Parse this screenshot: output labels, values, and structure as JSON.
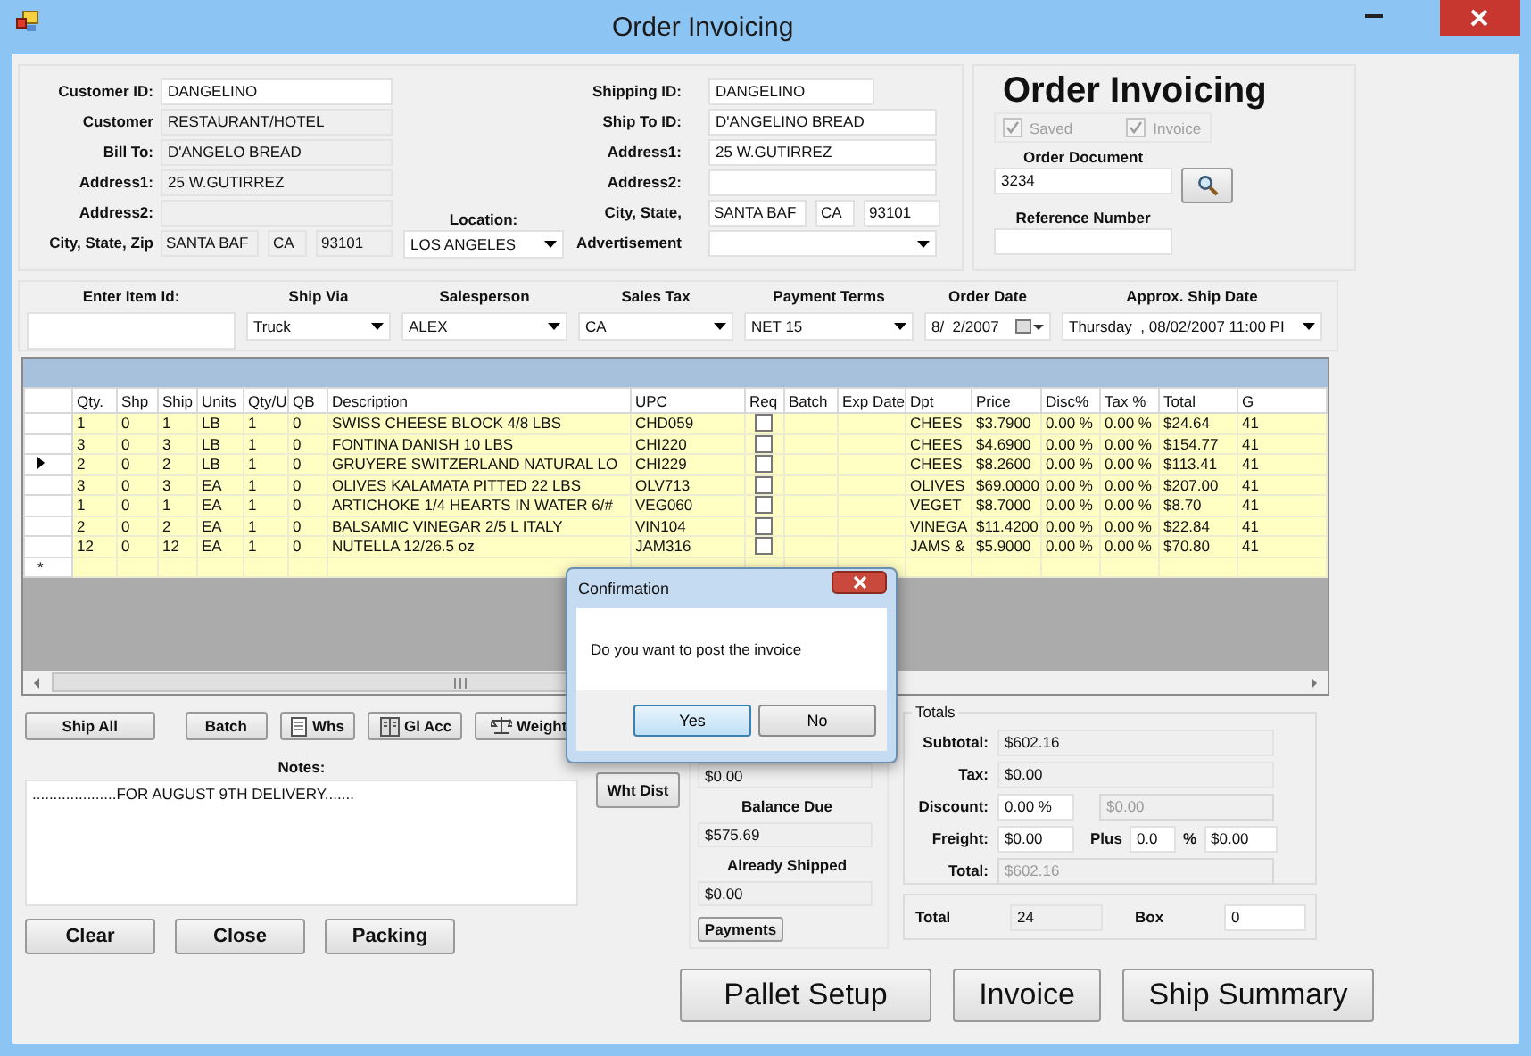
{
  "window": {
    "title": "Order Invoicing"
  },
  "customer": {
    "fields": [
      {
        "label": "Customer ID:",
        "kind": "single",
        "value": "DANGELINO",
        "readonly": false
      },
      {
        "label": "Customer",
        "kind": "single",
        "value": "RESTAURANT/HOTEL",
        "readonly": true
      },
      {
        "label": "Bill To:",
        "kind": "single",
        "value": "D'ANGELO BREAD",
        "readonly": true
      },
      {
        "label": "Address1:",
        "kind": "single",
        "value": "25 W.GUTIRREZ",
        "readonly": true
      },
      {
        "label": "Address2:",
        "kind": "single",
        "readonly": true
      },
      {
        "label": "City, State, Zip",
        "kind": "triple",
        "values": [
          "SANTA BAF",
          "CA",
          "93101"
        ],
        "readonly": true
      }
    ]
  },
  "location": {
    "label": "Location:",
    "value": "LOS ANGELES"
  },
  "shipping": {
    "fields": [
      {
        "label": "Shipping ID:",
        "kind": "short",
        "value": "DANGELINO",
        "readonly": false
      },
      {
        "label": "Ship To ID:",
        "kind": "single",
        "value": "D'ANGELINO BREAD",
        "readonly": false
      },
      {
        "label": "Address1:",
        "kind": "single",
        "value": "25 W.GUTIRREZ",
        "readonly": false
      },
      {
        "label": "Address2:",
        "kind": "single",
        "readonly": false
      },
      {
        "label": "City, State,",
        "kind": "triple",
        "values": [
          "SANTA BAF",
          "CA",
          "93101"
        ],
        "readonly": false
      },
      {
        "label": "Advertisement",
        "kind": "dropdown",
        "readonly": false
      }
    ]
  },
  "order_panel": {
    "heading": "Order Invoicing",
    "checks": [
      {
        "label": "Saved",
        "checked": true,
        "disabled": true
      },
      {
        "label": "Invoice",
        "checked": true,
        "disabled": true
      }
    ],
    "document_label": "Order Document",
    "document_value": "3234",
    "reference_label": "Reference Number"
  },
  "filters": [
    {
      "label": "Enter Item Id:",
      "kind": "text"
    },
    {
      "label": "Ship Via",
      "kind": "dropdown",
      "value": "Truck"
    },
    {
      "label": "Salesperson",
      "kind": "dropdown",
      "value": "ALEX"
    },
    {
      "label": "Sales Tax",
      "kind": "dropdown",
      "value": "CA"
    },
    {
      "label": "Payment Terms",
      "kind": "dropdown",
      "value": "NET 15"
    },
    {
      "label": "Order Date",
      "kind": "date",
      "value": "8/  2/2007"
    },
    {
      "label": "Approx. Ship  Date",
      "kind": "dropdown",
      "value": "Thursday  , 08/02/2007 11:00 PI"
    }
  ],
  "grid": {
    "columns": [
      {
        "label": "Qty.",
        "kind": "text"
      },
      {
        "label": "Shp",
        "kind": "text"
      },
      {
        "label": "Ship",
        "kind": "text"
      },
      {
        "label": "Units",
        "kind": "text"
      },
      {
        "label": "Qty/U",
        "kind": "text"
      },
      {
        "label": "QB",
        "kind": "text"
      },
      {
        "label": "Description",
        "kind": "text"
      },
      {
        "label": "UPC",
        "kind": "text"
      },
      {
        "label": "Req",
        "kind": "check"
      },
      {
        "label": "Batch",
        "kind": "empty"
      },
      {
        "label": "Exp Date",
        "kind": "empty"
      },
      {
        "label": "Dpt",
        "kind": "text"
      },
      {
        "label": "Price",
        "kind": "text"
      },
      {
        "label": "Disc%",
        "kind": "text"
      },
      {
        "label": "Tax %",
        "kind": "text"
      },
      {
        "label": "Total",
        "kind": "text"
      },
      {
        "label": "G",
        "kind": "text"
      }
    ],
    "rows": [
      {
        "selected": false,
        "req": false,
        "values": [
          "1",
          "0",
          "1",
          "LB",
          "1",
          "0",
          "SWISS CHEESE BLOCK 4/8 LBS",
          "CHD059",
          "CHEES",
          "$3.7900",
          "0.00 %",
          "0.00 %",
          "$24.64",
          "41"
        ]
      },
      {
        "selected": false,
        "req": false,
        "values": [
          "3",
          "0",
          "3",
          "LB",
          "1",
          "0",
          "FONTINA DANISH 10 LBS",
          "CHI220",
          "CHEES",
          "$4.6900",
          "0.00 %",
          "0.00 %",
          "$154.77",
          "41"
        ]
      },
      {
        "selected": true,
        "req": false,
        "values": [
          "2",
          "0",
          "2",
          "LB",
          "1",
          "0",
          "GRUYERE SWITZERLAND NATURAL LO",
          "CHI229",
          "CHEES",
          "$8.2600",
          "0.00 %",
          "0.00 %",
          "$113.41",
          "41"
        ]
      },
      {
        "selected": false,
        "req": false,
        "values": [
          "3",
          "0",
          "3",
          "EA",
          "1",
          "0",
          "OLIVES KALAMATA PITTED 22 LBS",
          "OLV713",
          "OLIVES",
          "$69.0000",
          "0.00 %",
          "0.00 %",
          "$207.00",
          "41"
        ]
      },
      {
        "selected": false,
        "req": false,
        "values": [
          "1",
          "0",
          "1",
          "EA",
          "1",
          "0",
          "ARTICHOKE 1/4 HEARTS IN WATER 6/#",
          "VEG060",
          "VEGET",
          "$8.7000",
          "0.00 %",
          "0.00 %",
          "$8.70",
          "41"
        ]
      },
      {
        "selected": false,
        "req": false,
        "values": [
          "2",
          "0",
          "2",
          "EA",
          "1",
          "0",
          "BALSAMIC VINEGAR 2/5 L ITALY",
          "VIN104",
          "VINEGA",
          "$11.4200",
          "0.00 %",
          "0.00 %",
          "$22.84",
          "41"
        ]
      },
      {
        "selected": false,
        "req": false,
        "values": [
          "12",
          "0",
          "12",
          "EA",
          "1",
          "0",
          "NUTELLA 12/26.5 oz",
          "JAM316",
          "JAMS &",
          "$5.9000",
          "0.00 %",
          "0.00 %",
          "$70.80",
          "41"
        ]
      }
    ],
    "new_row_marker": "*"
  },
  "tool_buttons": [
    {
      "label": "Ship All",
      "kind": "plain"
    },
    {
      "label": "Batch",
      "kind": "plain"
    },
    {
      "label": "Whs",
      "kind": "page"
    },
    {
      "label": "Gl Acc",
      "kind": "book"
    },
    {
      "label": "Weight",
      "kind": "scale"
    }
  ],
  "notes": {
    "label": "Notes:",
    "value": "....................FOR AUGUST 9TH DELIVERY......."
  },
  "form_buttons": [
    "Clear",
    "Close",
    "Packing"
  ],
  "wht_dist_button": "Wht Dist",
  "balance": {
    "top_value": "$0.00",
    "due_label": "Balance Due",
    "due_value": "$575.69",
    "shipped_label": "Already Shipped",
    "shipped_value": "$0.00",
    "payments_button": "Payments"
  },
  "totals": {
    "legend": "Totals",
    "rows": [
      {
        "kind": "single",
        "label": "Subtotal:",
        "fields": [
          {
            "value": "$602.16",
            "readonly": true,
            "disabled": false
          }
        ]
      },
      {
        "kind": "single",
        "label": "Tax:",
        "fields": [
          {
            "value": "$0.00",
            "readonly": true,
            "disabled": false
          }
        ]
      },
      {
        "kind": "pair",
        "label": "Discount:",
        "fields": [
          {
            "value": "0.00 %",
            "readonly": false,
            "disabled": false
          },
          {
            "value": "$0.00",
            "readonly": true,
            "disabled": true
          }
        ]
      },
      {
        "kind": "freight",
        "label": "Freight:",
        "fields": [
          {
            "value": "$0.00",
            "readonly": false,
            "disabled": false
          },
          {
            "value": "0.0",
            "readonly": false,
            "disabled": false
          },
          {
            "value": "$0.00",
            "readonly": false,
            "disabled": false
          }
        ],
        "plus_label": "Plus",
        "percent_sign": "%"
      },
      {
        "kind": "single",
        "label": "Total:",
        "fields": [
          {
            "value": "$602.16",
            "readonly": true,
            "disabled": true
          }
        ]
      }
    ]
  },
  "summary": {
    "total_label": "Total",
    "total_value": "24",
    "box_label": "Box",
    "box_value": "0"
  },
  "actions": [
    "Pallet Setup",
    "Invoice",
    "Ship Summary"
  ],
  "dialog": {
    "title": "Confirmation",
    "message": "Do you want to post the invoice",
    "buttons": [
      {
        "label": "Yes",
        "default": true
      },
      {
        "label": "No",
        "default": false
      }
    ]
  }
}
